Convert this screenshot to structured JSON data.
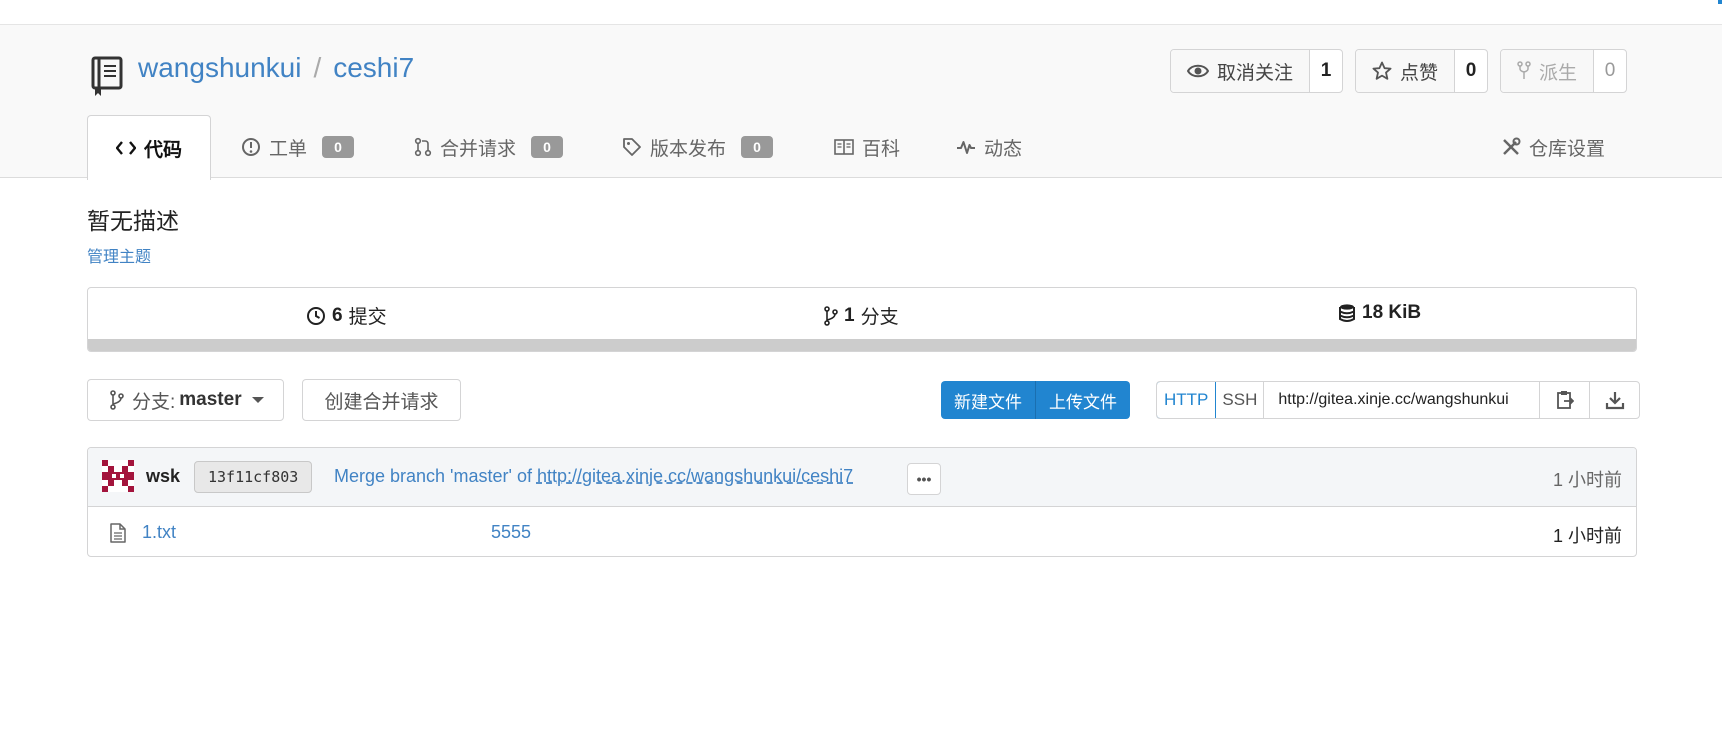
{
  "repo": {
    "owner": "wangshunkui",
    "separator": "/",
    "name": "ceshi7"
  },
  "actions": {
    "watch": {
      "label": "取消关注",
      "count": "1"
    },
    "star": {
      "label": "点赞",
      "count": "0"
    },
    "fork": {
      "label": "派生",
      "count": "0"
    }
  },
  "tabs": [
    {
      "label": "代码",
      "icon": "code-icon",
      "active": true
    },
    {
      "label": "工单",
      "icon": "issue-icon",
      "badge": "0"
    },
    {
      "label": "合并请求",
      "icon": "pull-request-icon",
      "badge": "0"
    },
    {
      "label": "版本发布",
      "icon": "tag-icon",
      "badge": "0"
    },
    {
      "label": "百科",
      "icon": "book-icon"
    },
    {
      "label": "动态",
      "icon": "pulse-icon"
    },
    {
      "label": "仓库设置",
      "icon": "tools-icon"
    }
  ],
  "description": "暂无描述",
  "manage_topics": "管理主题",
  "stats": {
    "commits": {
      "count": "6",
      "label": "提交"
    },
    "branches": {
      "count": "1",
      "label": "分支"
    },
    "size": {
      "count": "18 KiB",
      "label": ""
    }
  },
  "branch_select": {
    "prefix": "分支:",
    "value": "master"
  },
  "new_pr_label": "创建合并请求",
  "new_file_label": "新建文件",
  "upload_file_label": "上传文件",
  "clone": {
    "http": "HTTP",
    "ssh": "SSH",
    "url": "http://gitea.xinje.cc/wangshunkui"
  },
  "latest_commit": {
    "author": "wsk",
    "sha": "13f11cf803",
    "message_prefix": "Merge branch 'master' of ",
    "message_link": "http://gitea.xinje.cc/wangshunkui/ceshi7",
    "ellipsis": "•••",
    "time": "1 小时前"
  },
  "files": [
    {
      "name": "1.txt",
      "message": "5555",
      "time": "1 小时前"
    }
  ],
  "colors": {
    "accent": "#2185d0",
    "link": "#4183c4",
    "badge": "#999999"
  }
}
